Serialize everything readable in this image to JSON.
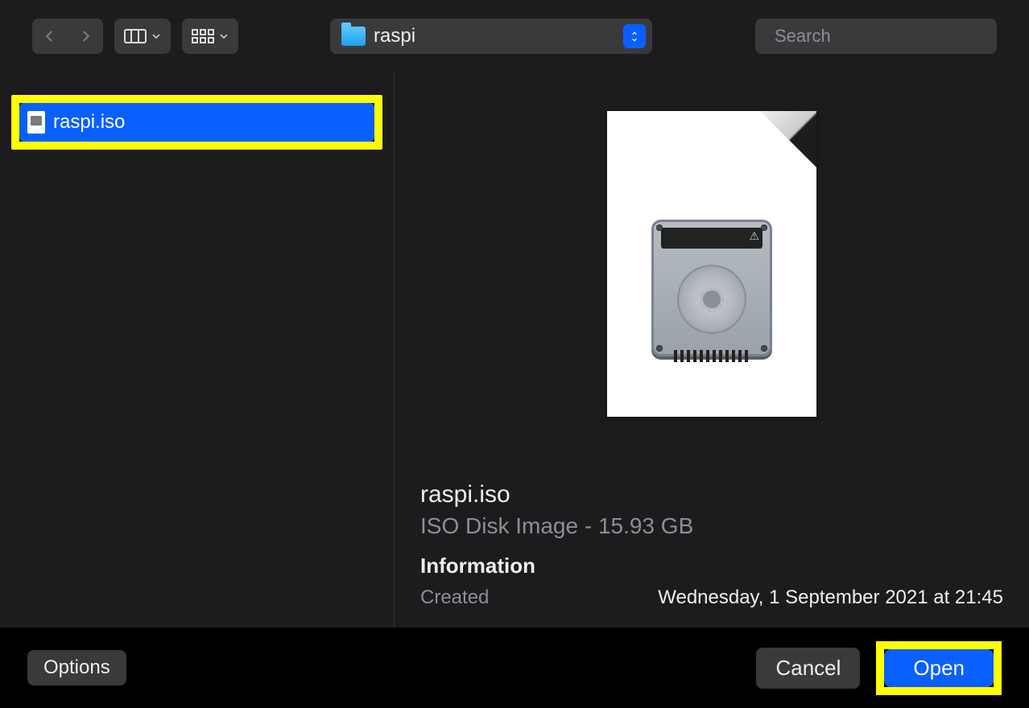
{
  "toolbar": {
    "path_label": "raspi",
    "search_placeholder": "Search"
  },
  "filelist": {
    "items": [
      {
        "name": "raspi.iso"
      }
    ]
  },
  "preview": {
    "filename": "raspi.iso",
    "kind_size": "ISO Disk Image - 15.93 GB",
    "info_heading": "Information",
    "created_label": "Created",
    "created_value": "Wednesday, 1 September 2021 at 21:45"
  },
  "footer": {
    "options": "Options",
    "cancel": "Cancel",
    "open": "Open"
  }
}
